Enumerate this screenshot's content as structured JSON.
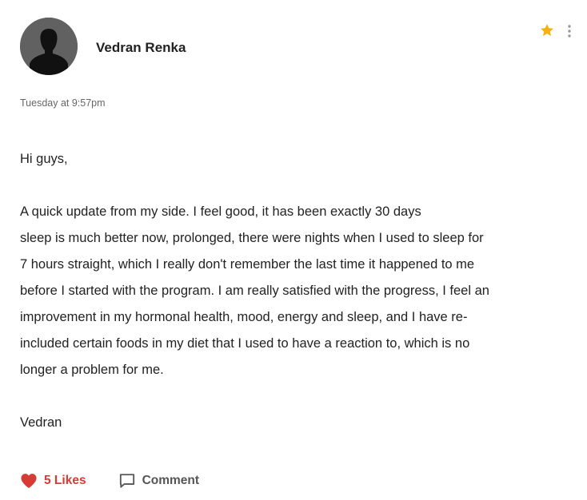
{
  "post": {
    "author": {
      "name": "Vedran Renka",
      "avatar_icon": "person-silhouette-icon"
    },
    "timestamp": "Tuesday at 9:57pm",
    "body": {
      "greeting": "Hi guys,",
      "lines": [
        "A quick update from my side.  I feel good, it has been exactly 30 days",
        "sleep is much better now, prolonged, there were nights when I used to sleep for",
        "7 hours straight, which I really don't remember the last time it happened to me",
        "before I started with the program. I am really satisfied with the progress, I feel an",
        "improvement in my hormonal health, mood, energy and sleep, and I have re-",
        "included certain foods in my diet that I used to have a reaction to, which is no",
        "longer a problem for me."
      ],
      "signoff": "Vedran"
    },
    "actions": {
      "likes_label": "5 Likes",
      "comment_label": "Comment"
    },
    "icons": {
      "star": "star-icon",
      "more": "more-vertical-icon",
      "heart": "heart-icon",
      "comment": "comment-icon"
    },
    "colors": {
      "accent_like": "#d63b34",
      "star": "#f5b014",
      "avatar_bg": "#616161"
    }
  }
}
